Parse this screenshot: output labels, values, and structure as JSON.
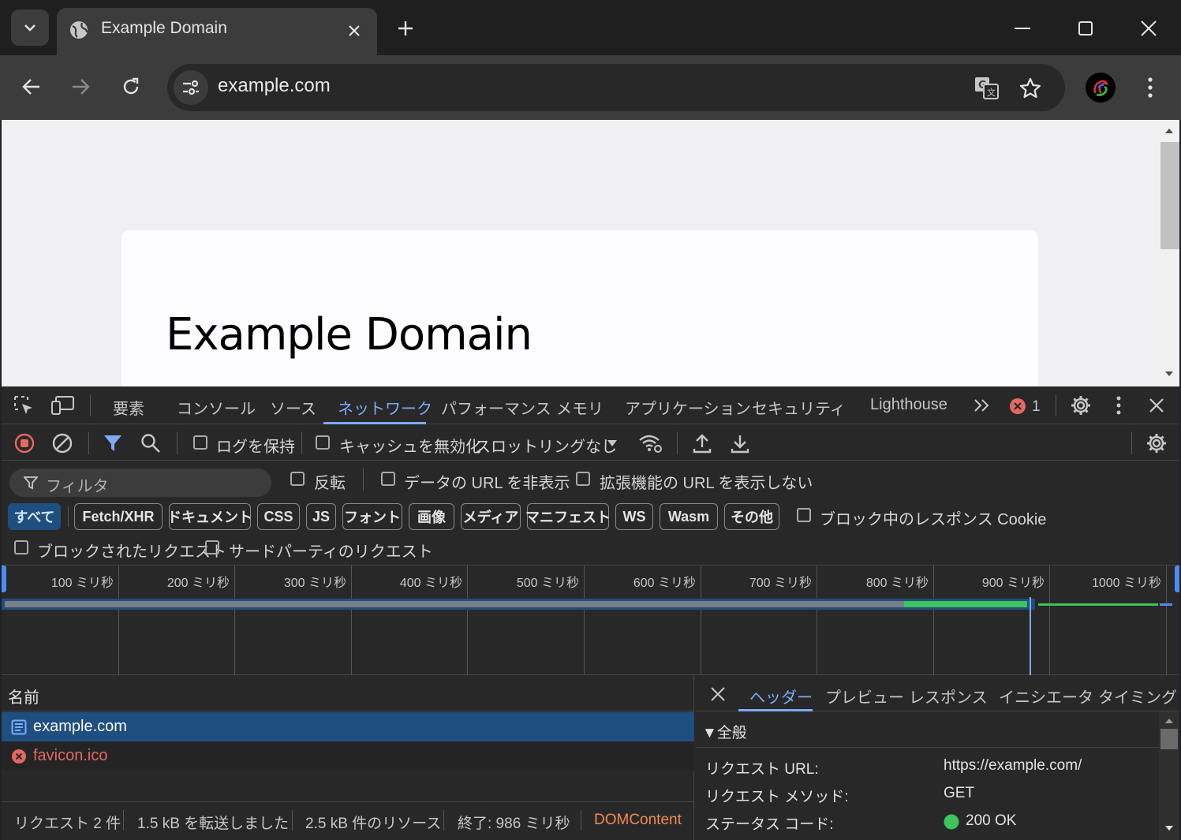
{
  "browser": {
    "tab_title": "Example Domain",
    "url": "example.com",
    "icons": [
      "tab-list-icon",
      "globe-icon",
      "close-icon",
      "new-tab-icon",
      "minimize-icon",
      "maximize-icon",
      "window-close-icon",
      "back-icon",
      "forward-icon",
      "reload-icon",
      "site-info-icon",
      "translate-icon",
      "bookmark-star-icon",
      "profile-avatar",
      "more-menu-icon"
    ]
  },
  "page": {
    "heading": "Example Domain"
  },
  "devtools": {
    "tabs": [
      "要素",
      "コンソール",
      "ソース",
      "ネットワーク",
      "パフォーマンス",
      "メモリ",
      "アプリケーション",
      "セキュリティ",
      "Lighthouse"
    ],
    "active_tab": "ネットワーク",
    "error_count": "1",
    "toolbar": {
      "preserve_log": "ログを保持",
      "disable_cache": "キャッシュを無効化",
      "throttling": "スロットリングなし"
    },
    "filter": {
      "placeholder": "フィルタ",
      "invert": "反転",
      "hide_data_urls": "データの URL を非表示",
      "hide_extension_urls": "拡張機能の URL を表示しない",
      "blocked_cookies": "ブロック中のレスポンス Cookie",
      "blocked_requests": "ブロックされたリクエスト",
      "third_party": "サードパーティのリクエスト"
    },
    "type_filters": [
      "すべて",
      "Fetch/XHR",
      "ドキュメント",
      "CSS",
      "JS",
      "フォント",
      "画像",
      "メディア",
      "マニフェスト",
      "WS",
      "Wasm",
      "その他"
    ],
    "timeline_ticks": [
      "100 ミリ秒",
      "200 ミリ秒",
      "300 ミリ秒",
      "400 ミリ秒",
      "500 ミリ秒",
      "600 ミリ秒",
      "700 ミリ秒",
      "800 ミリ秒",
      "900 ミリ秒",
      "1000 ミリ秒"
    ],
    "requests": {
      "column_name": "名前",
      "rows": [
        {
          "name": "example.com",
          "kind": "document"
        },
        {
          "name": "favicon.ico",
          "kind": "error"
        }
      ]
    },
    "status_bar": {
      "requests": "リクエスト 2 件",
      "transferred": "1.5 kB を転送しました",
      "resources": "2.5 kB 件のリソース",
      "finish": "終了: 986 ミリ秒",
      "domcontent": "DOMContent"
    },
    "details": {
      "tabs": [
        "ヘッダー",
        "プレビュー",
        "レスポンス",
        "イニシエータ",
        "タイミング"
      ],
      "active_tab": "ヘッダー",
      "section": "▼全般",
      "rows": [
        {
          "key": "リクエスト URL:",
          "value": "https://example.com/"
        },
        {
          "key": "リクエスト メソッド:",
          "value": "GET"
        },
        {
          "key": "ステータス コード:",
          "value": "200 OK"
        }
      ]
    },
    "colors": {
      "accent": "#7cacf8",
      "selected_row": "#1f4e80",
      "error": "#e46962",
      "status_ok": "#3ec45c",
      "domcontent": "#f28b54"
    }
  }
}
